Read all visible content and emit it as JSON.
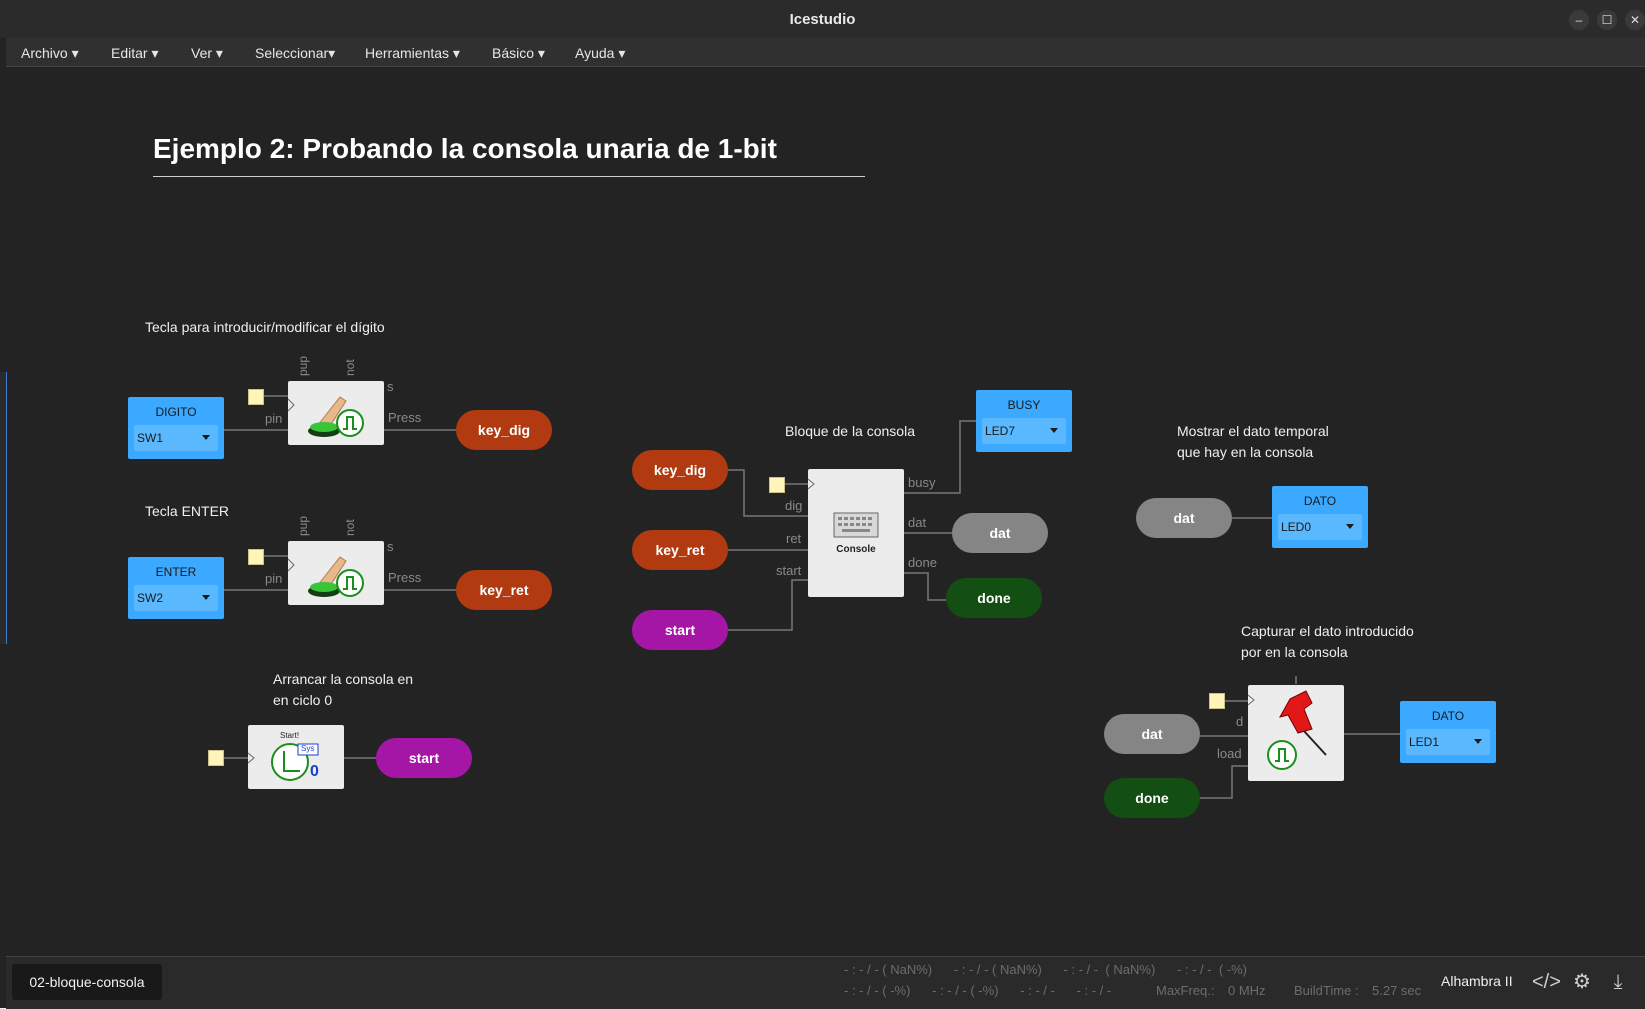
{
  "app": {
    "title": "Icestudio"
  },
  "window_controls": {
    "minimize": "–",
    "maximize": "☐",
    "close": "✕"
  },
  "menu": [
    {
      "label": "Archivo"
    },
    {
      "label": "Editar"
    },
    {
      "label": "Ver"
    },
    {
      "label": "Seleccionar"
    },
    {
      "label": "Herramientas"
    },
    {
      "label": "Básico"
    },
    {
      "label": "Ayuda"
    }
  ],
  "canvas": {
    "heading": "Ejemplo 2: Probando la consola unaria de 1-bit",
    "notes": {
      "digit_key": "Tecla para introducir/modificar el dígito",
      "enter_key": "Tecla ENTER",
      "start_line1": "Arrancar la consola en",
      "start_line2": "en ciclo 0",
      "console_block": "Bloque de la consola",
      "show_line1": "Mostrar el dato temporal",
      "show_line2": "que hay en la consola",
      "capture_line1": "Capturar el dato introducido",
      "capture_line2": "por en la consola"
    },
    "inputs": {
      "digito": {
        "title": "DIGITO",
        "value": "SW1"
      },
      "enter": {
        "title": "ENTER",
        "value": "SW2"
      }
    },
    "outputs": {
      "busy": {
        "title": "BUSY",
        "value": "LED7"
      },
      "dato0": {
        "title": "DATO",
        "value": "LED0"
      },
      "dato1": {
        "title": "DATO",
        "value": "LED1"
      }
    },
    "labels": {
      "key_dig": "key_dig",
      "key_ret": "key_ret",
      "start": "start",
      "dat": "dat",
      "done": "done"
    },
    "ports": {
      "pup": "pup",
      "not": "not",
      "s": "s",
      "pin": "pin",
      "press": "Press",
      "busy": "busy",
      "dig": "dig",
      "dat": "dat",
      "ret": "ret",
      "start": "start",
      "done": "done",
      "d": "d",
      "load": "load"
    },
    "blocks": {
      "console": "Console",
      "start_title": "Start!",
      "start_sys": "Sys",
      "start_zero": "0"
    }
  },
  "status": {
    "file": "02-bloque-consola",
    "line1": "- : - / - ( NaN%)      - : - / - ( NaN%)      - : - / -  ( NaN%)      - : - / -  ( -%)",
    "line2": "- : - / - ( -%)      - : - / - ( -%)      - : - / -      - : - / -",
    "maxfreq_label": "MaxFreq.:",
    "maxfreq_value": "0 MHz",
    "buildtime_label": "BuildTime :",
    "buildtime_value": "5.27 sec",
    "board": "Alhambra II"
  },
  "colors": {
    "label_red": "#b23a11",
    "label_purple": "#a616a6",
    "label_gray": "#858585",
    "label_green": "#134e13",
    "io_blue": "#3aa9ff"
  },
  "icons": [
    "minimize-icon",
    "maximize-icon",
    "close-icon",
    "code-icon",
    "settings-icon",
    "download-icon",
    "push-button-icon",
    "pushpin-icon",
    "keyboard-icon",
    "start-clock-icon"
  ]
}
